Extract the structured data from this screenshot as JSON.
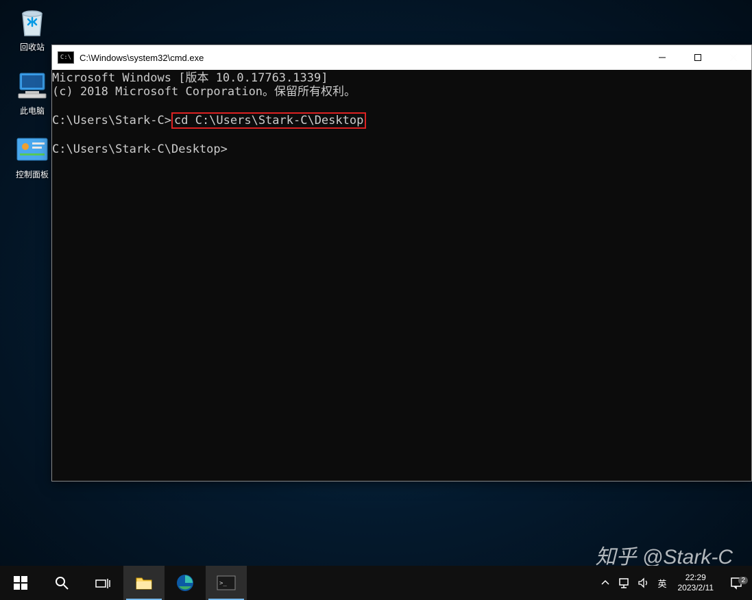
{
  "desktop": {
    "icons": [
      {
        "name": "recycle-bin",
        "label": "回收站"
      },
      {
        "name": "this-pc",
        "label": "此电脑"
      },
      {
        "name": "control-panel",
        "label": "控制面板"
      }
    ]
  },
  "cmd_window": {
    "title": "C:\\Windows\\system32\\cmd.exe",
    "lines": {
      "version": "Microsoft Windows [版本 10.0.17763.1339]",
      "copyright": "(c) 2018 Microsoft Corporation。保留所有权利。",
      "prompt1": "C:\\Users\\Stark-C>",
      "input1": "cd C:\\Users\\Stark-C\\Desktop",
      "prompt2": "C:\\Users\\Stark-C\\Desktop>"
    }
  },
  "taskbar": {
    "ime": "英",
    "time": "22:29",
    "date": "2023/2/11",
    "notif_count": "2"
  },
  "watermark": "知乎 @Stark-C"
}
